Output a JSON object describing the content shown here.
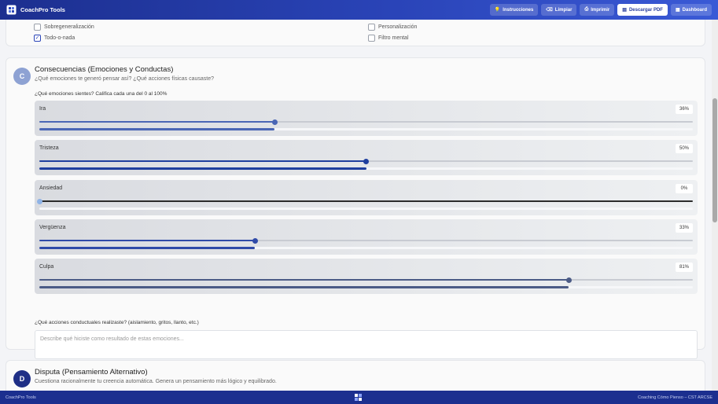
{
  "app": {
    "brand": "CoachPro Tools",
    "nav": [
      {
        "label": "Instrucciones",
        "icon": "lightbulb-icon",
        "glyph": "💡"
      },
      {
        "label": "Limpiar",
        "icon": "eraser-icon",
        "glyph": "⌫"
      },
      {
        "label": "Imprimir",
        "icon": "printer-icon",
        "glyph": "⎙"
      },
      {
        "label": "Descargar PDF",
        "icon": "file-pdf-icon",
        "glyph": "▤"
      },
      {
        "label": "Dashboard",
        "icon": "dashboard-icon",
        "glyph": "▦"
      }
    ]
  },
  "distortions": [
    {
      "label": "Sobregeneralización",
      "checked": false
    },
    {
      "label": "Personalización",
      "checked": false
    },
    {
      "label": "Todo-o-nada",
      "checked": true
    },
    {
      "label": "Filtro mental",
      "checked": false
    }
  ],
  "section_c": {
    "badge": "C",
    "title": "Consecuencias (Emociones y Conductas)",
    "subtitle": "¿Qué emociones te generó pensar así? ¿Qué acciones físicas causaste?",
    "emotions_question": "¿Qué emociones sientes? Califica cada una del 0 al 100%",
    "emotions": [
      {
        "label": "Ira",
        "value": 36,
        "display": "36%",
        "color": "#4a66b5"
      },
      {
        "label": "Tristeza",
        "value": 50,
        "display": "50%",
        "color": "#1f3f9e"
      },
      {
        "label": "Ansiedad",
        "value": 0,
        "display": "0%",
        "color": "#8fb3e6"
      },
      {
        "label": "Vergüenza",
        "value": 33,
        "display": "33%",
        "color": "#2f4aa8"
      },
      {
        "label": "Culpa",
        "value": 81,
        "display": "81%",
        "color": "#4b5b86"
      }
    ],
    "actions_question": "¿Qué acciones conductuales realizaste? (aislamiento, gritos, llanto, etc.)",
    "actions_placeholder": "Describe qué hiciste como resultado de estas emociones...",
    "actions_value": ""
  },
  "section_d": {
    "badge": "D",
    "title": "Disputa (Pensamiento Alternativo)",
    "subtitle": "Cuestiona racionalmente tu creencia automática. Genera un pensamiento más lógico y equilibrado."
  },
  "footer": {
    "left": "CoachPro Tools",
    "right": "Coaching Cómo Pienso – CST ARCSE"
  }
}
